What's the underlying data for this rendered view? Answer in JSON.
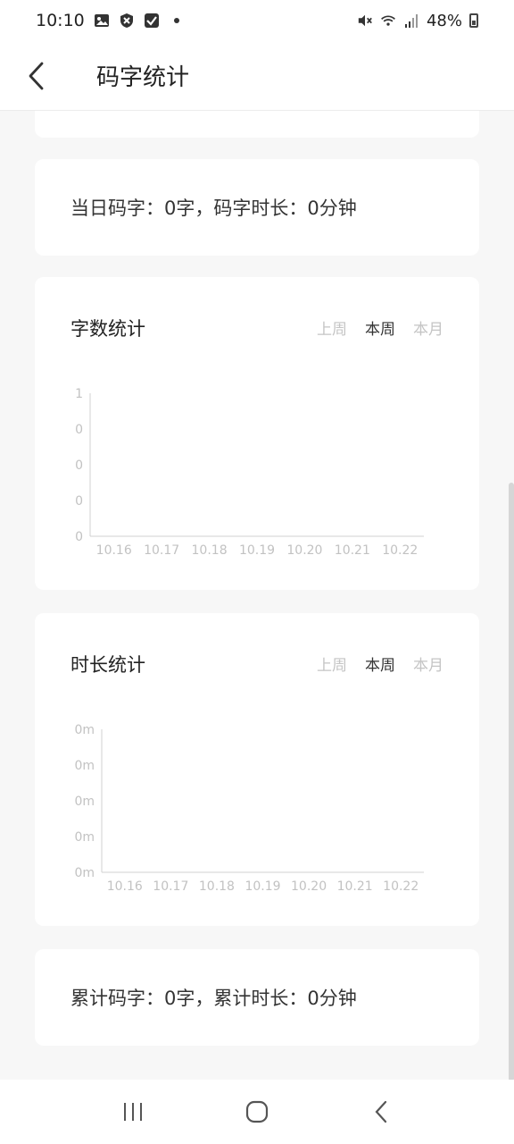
{
  "status_bar": {
    "time": "10:10",
    "battery_percent": "48%",
    "icons": [
      "image-icon",
      "shield-icon",
      "check-icon",
      "dot-icon",
      "mute-icon",
      "wifi-icon",
      "signal-icon",
      "battery-icon"
    ]
  },
  "header": {
    "title": "码字统计",
    "back_icon": "chevron-left-icon"
  },
  "today_summary": "当日码字：0字，码字时长：0分钟",
  "total_summary": "累计码字：0字，累计时长：0分钟",
  "word_chart": {
    "title": "字数统计",
    "tabs": [
      {
        "label": "上周",
        "active": false
      },
      {
        "label": "本周",
        "active": true
      },
      {
        "label": "本月",
        "active": false
      }
    ]
  },
  "duration_chart": {
    "title": "时长统计",
    "tabs": [
      {
        "label": "上周",
        "active": false
      },
      {
        "label": "本周",
        "active": true
      },
      {
        "label": "本月",
        "active": false
      }
    ]
  },
  "chart_data": [
    {
      "type": "line",
      "categories": [
        "10.16",
        "10.17",
        "10.18",
        "10.19",
        "10.20",
        "10.21",
        "10.22"
      ],
      "series": [
        {
          "values": [
            0,
            0,
            0,
            0,
            0,
            0,
            0
          ]
        }
      ],
      "y_tick_labels": [
        "1",
        "0",
        "0",
        "0",
        "0"
      ],
      "ylim": [
        0,
        1
      ],
      "grid": false
    },
    {
      "type": "line",
      "categories": [
        "10.16",
        "10.17",
        "10.18",
        "10.19",
        "10.20",
        "10.21",
        "10.22"
      ],
      "series": [
        {
          "values": [
            0,
            0,
            0,
            0,
            0,
            0,
            0
          ]
        }
      ],
      "y_tick_labels": [
        "0m",
        "0m",
        "0m",
        "0m",
        "0m"
      ],
      "ylim": [
        0,
        1
      ],
      "grid": false
    }
  ],
  "colors": {
    "background": "#f7f7f7",
    "card": "#ffffff",
    "active_tab": "#333333",
    "inactive_tab": "#c4c4c4",
    "axis": "#d0d0d0"
  },
  "nav_bar": {
    "icons": [
      "recent-apps-icon",
      "home-icon",
      "back-icon"
    ]
  }
}
